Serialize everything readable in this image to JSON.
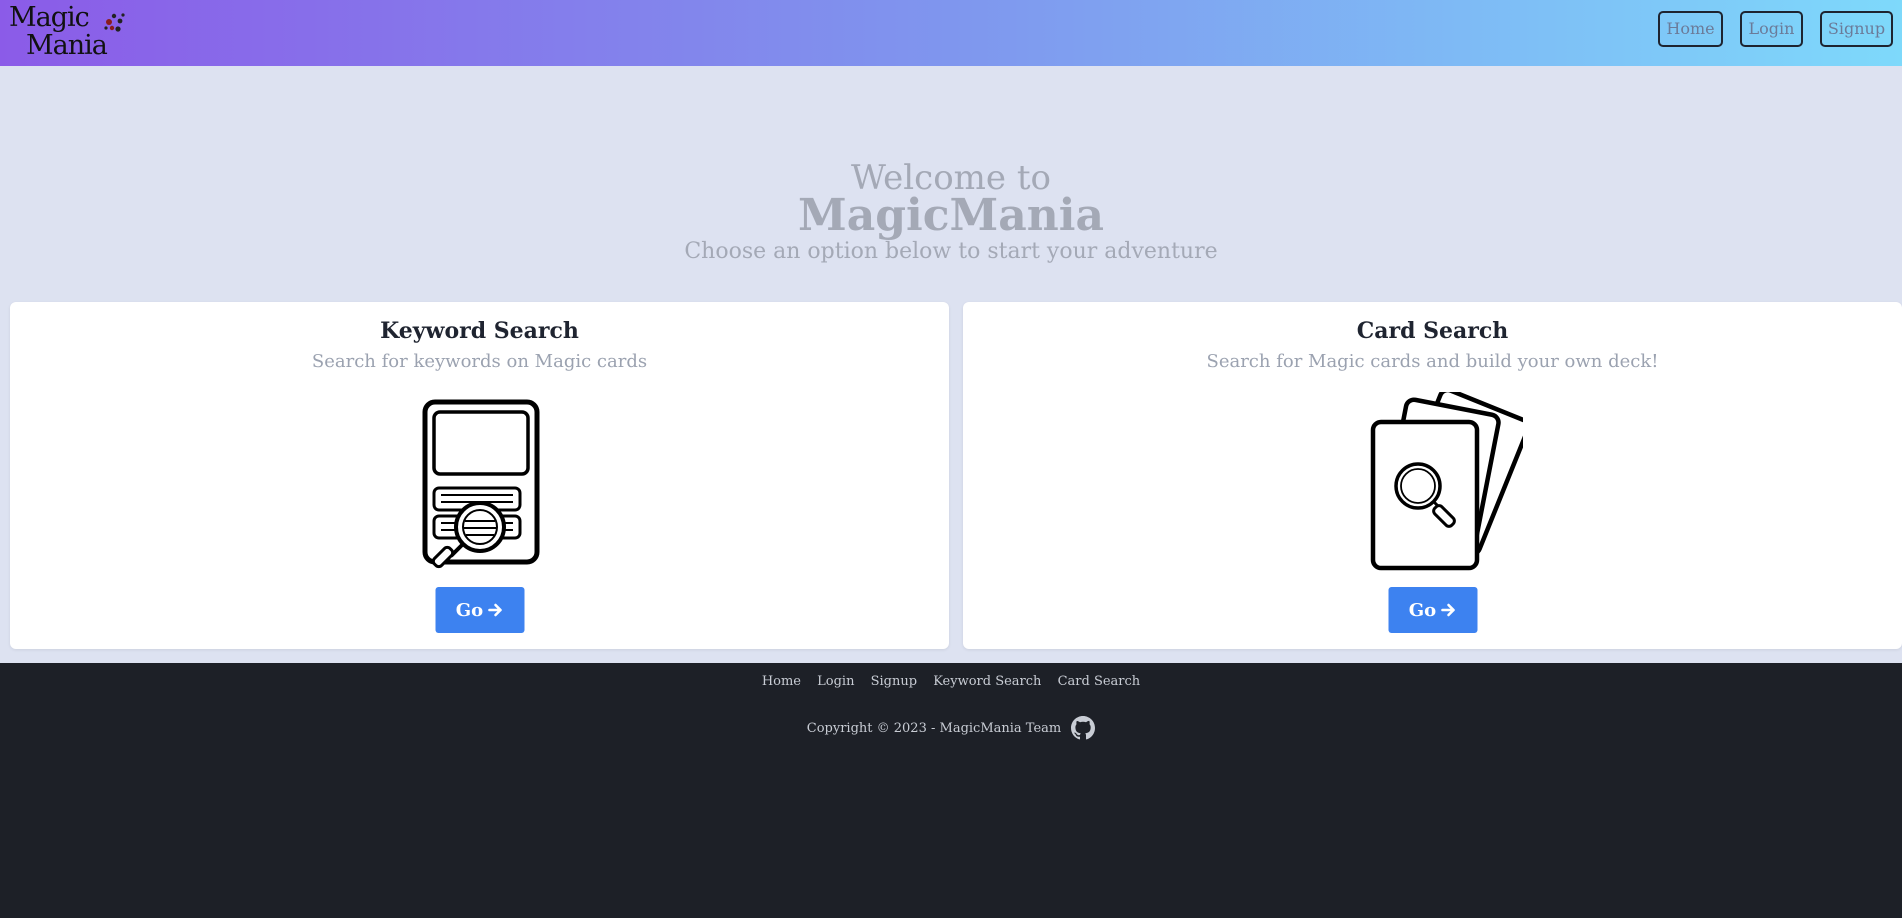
{
  "header": {
    "logo": {
      "line1": "Magic",
      "line2": "Mania"
    },
    "nav": [
      {
        "label": "Home"
      },
      {
        "label": "Login"
      },
      {
        "label": "Signup"
      }
    ]
  },
  "hero": {
    "welcome": "Welcome to",
    "title": "MagicMania",
    "subtitle": "Choose an option below to start your adventure"
  },
  "cards": [
    {
      "title": "Keyword Search",
      "description": "Search for keywords on Magic cards",
      "icon": "card-magnifier-icon",
      "button_label": "Go"
    },
    {
      "title": "Card Search",
      "description": "Search for Magic cards and build your own deck!",
      "icon": "card-stack-magnifier-icon",
      "button_label": "Go"
    }
  ],
  "footer": {
    "links": [
      "Home",
      "Login",
      "Signup",
      "Keyword Search",
      "Card Search"
    ],
    "copyright": "Copyright © 2023 - MagicMania Team",
    "icon": "github-icon"
  },
  "colors": {
    "accent": "#3d82f0",
    "header_gradient": [
      "#8b5be8",
      "#7f96ee",
      "#7ed9fb"
    ],
    "page_bg": "#dde2f1",
    "footer_bg": "#1d2027"
  }
}
